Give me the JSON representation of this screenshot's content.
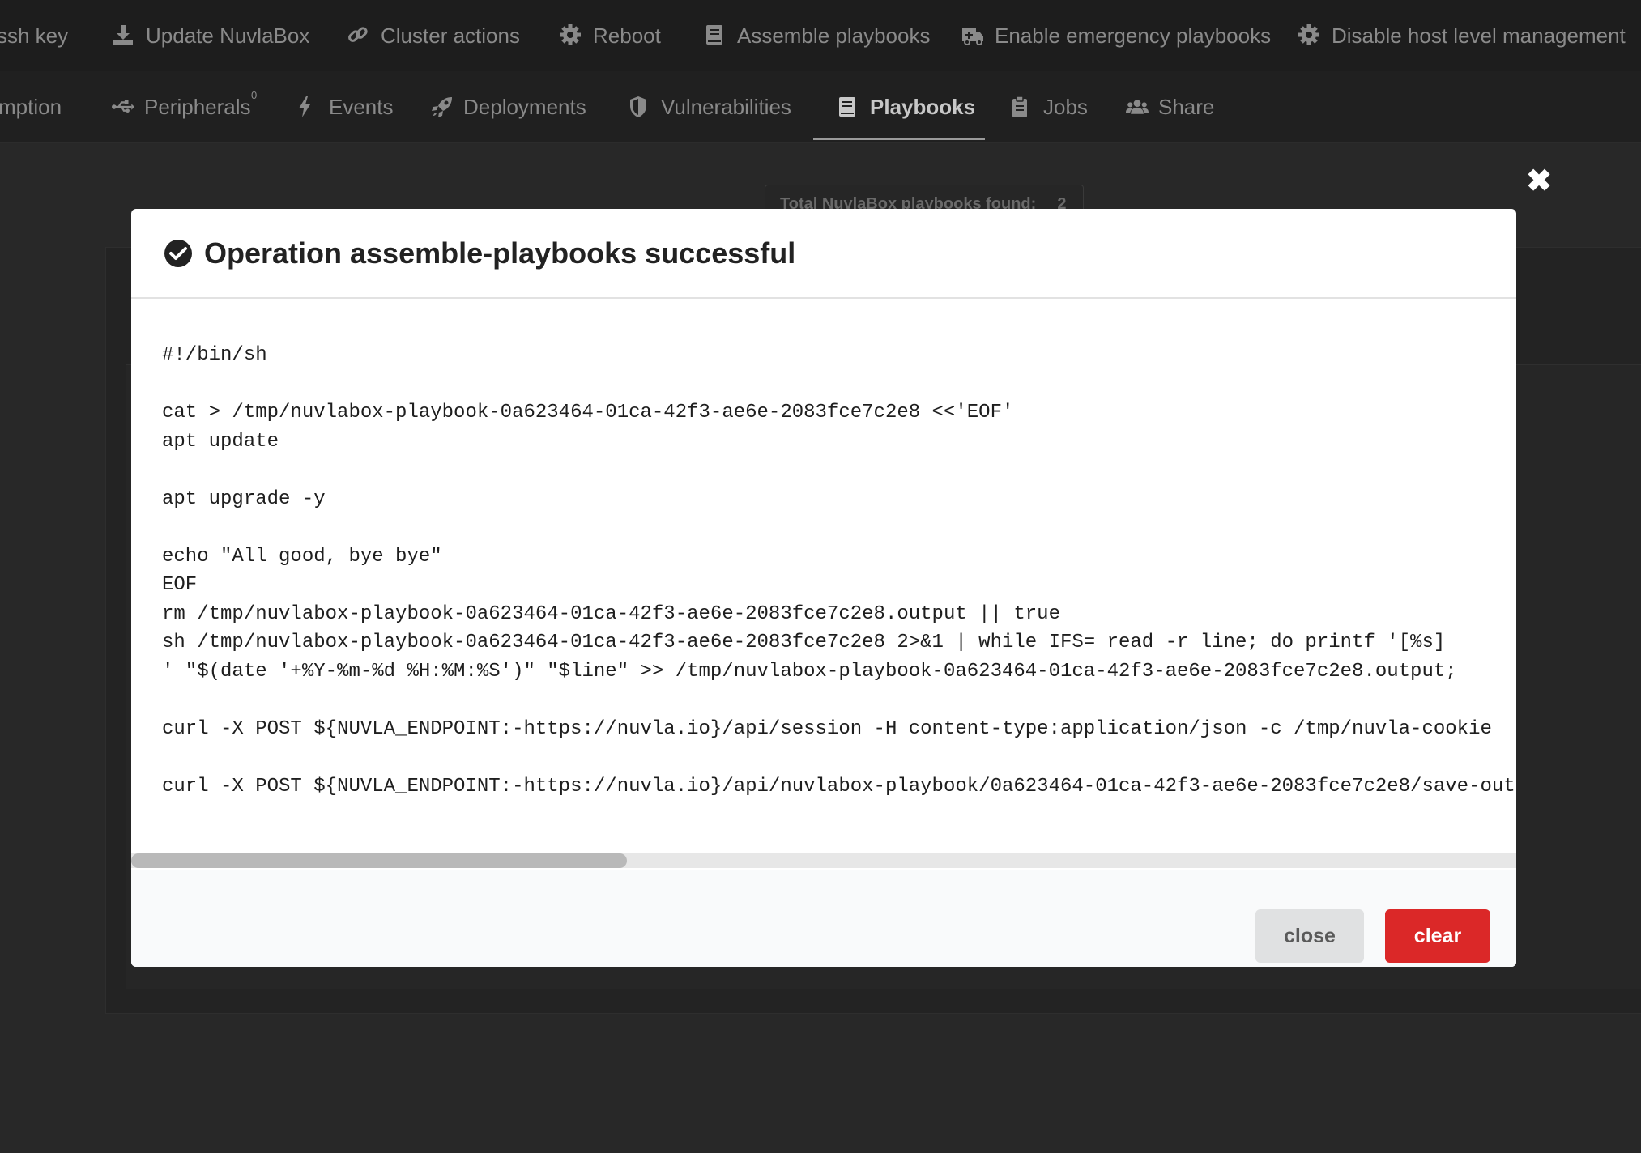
{
  "actions_bar": {
    "items": [
      {
        "label": "ssh key",
        "icon": "key-icon"
      },
      {
        "label": "Update NuvlaBox",
        "icon": "download-icon"
      },
      {
        "label": "Cluster actions",
        "icon": "link-icon"
      },
      {
        "label": "Reboot",
        "icon": "gear-icon"
      },
      {
        "label": "Assemble playbooks",
        "icon": "book-icon"
      },
      {
        "label": "Enable emergency playbooks",
        "icon": "ambulance-icon"
      },
      {
        "label": "Disable host level management",
        "icon": "gear-icon"
      }
    ]
  },
  "tabs_bar": {
    "items": [
      {
        "label": "mption",
        "icon": ""
      },
      {
        "label": "Peripherals",
        "icon": "usb-icon",
        "badge": "0"
      },
      {
        "label": "Events",
        "icon": "bolt-icon"
      },
      {
        "label": "Deployments",
        "icon": "rocket-icon"
      },
      {
        "label": "Vulnerabilities",
        "icon": "shield-icon"
      },
      {
        "label": "Playbooks",
        "icon": "book-icon",
        "active": true
      },
      {
        "label": "Jobs",
        "icon": "clipboard-icon"
      },
      {
        "label": "Share",
        "icon": "users-icon"
      }
    ]
  },
  "background": {
    "found_label": "Total NuvlaBox playbooks found:",
    "found_count": "2"
  },
  "modal": {
    "title": "Operation assemble-playbooks successful",
    "code_lines": [
      "#!/bin/sh",
      "",
      "cat > /tmp/nuvlabox-playbook-0a623464-01ca-42f3-ae6e-2083fce7c2e8 <<'EOF'",
      "apt update",
      "",
      "apt upgrade -y",
      "",
      "echo \"All good, bye bye\"",
      "EOF",
      "rm /tmp/nuvlabox-playbook-0a623464-01ca-42f3-ae6e-2083fce7c2e8.output || true",
      "sh /tmp/nuvlabox-playbook-0a623464-01ca-42f3-ae6e-2083fce7c2e8 2>&1 | while IFS= read -r line; do printf '[%s]",
      "' \"$(date '+%Y-%m-%d %H:%M:%S')\" \"$line\" >> /tmp/nuvlabox-playbook-0a623464-01ca-42f3-ae6e-2083fce7c2e8.output;",
      "",
      "curl -X POST ${NUVLA_ENDPOINT:-https://nuvla.io}/api/session -H content-type:application/json -c /tmp/nuvla-cookie",
      "",
      "curl -X POST ${NUVLA_ENDPOINT:-https://nuvla.io}/api/nuvlabox-playbook/0a623464-01ca-42f3-ae6e-2083fce7c2e8/save-output"
    ],
    "horizontal_scroll_fraction": 0.0,
    "close_label": "close",
    "clear_label": "clear",
    "colors": {
      "clear_button": "#db2828",
      "close_button": "#e0e1e2"
    }
  }
}
